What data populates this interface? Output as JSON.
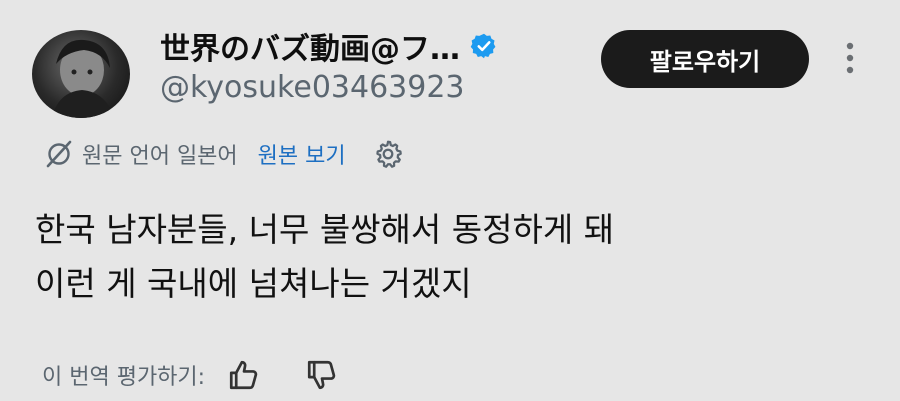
{
  "post": {
    "author": {
      "display_name": "世界のバズ動画@フ…",
      "handle": "@kyosuke03463923",
      "verified": true,
      "avatar": "avatar"
    },
    "follow_label": "팔로우하기",
    "more_icon": "more-vertical-icon",
    "translation": {
      "icon": "globe-off-icon",
      "source_language_label": "원문 언어 일본어",
      "show_original_label": "원본 보기",
      "settings_icon": "gear-icon"
    },
    "body": {
      "lines": [
        "한국 남자분들, 너무 불쌍해서 동정하게 돼",
        "이런 게 국내에 넘쳐나는 거겠지"
      ]
    },
    "rate_translation": {
      "label": "이 번역 평가하기:",
      "thumb_up_icon": "thumbs-up-icon",
      "thumb_down_icon": "thumbs-down-icon"
    }
  },
  "colors": {
    "background": "#e6e6e6",
    "text_primary": "#111111",
    "text_secondary": "#5b6670",
    "link_blue": "#1d6fc2",
    "verified_blue": "#1d9bf0",
    "button_dark": "#1b1b1b"
  }
}
